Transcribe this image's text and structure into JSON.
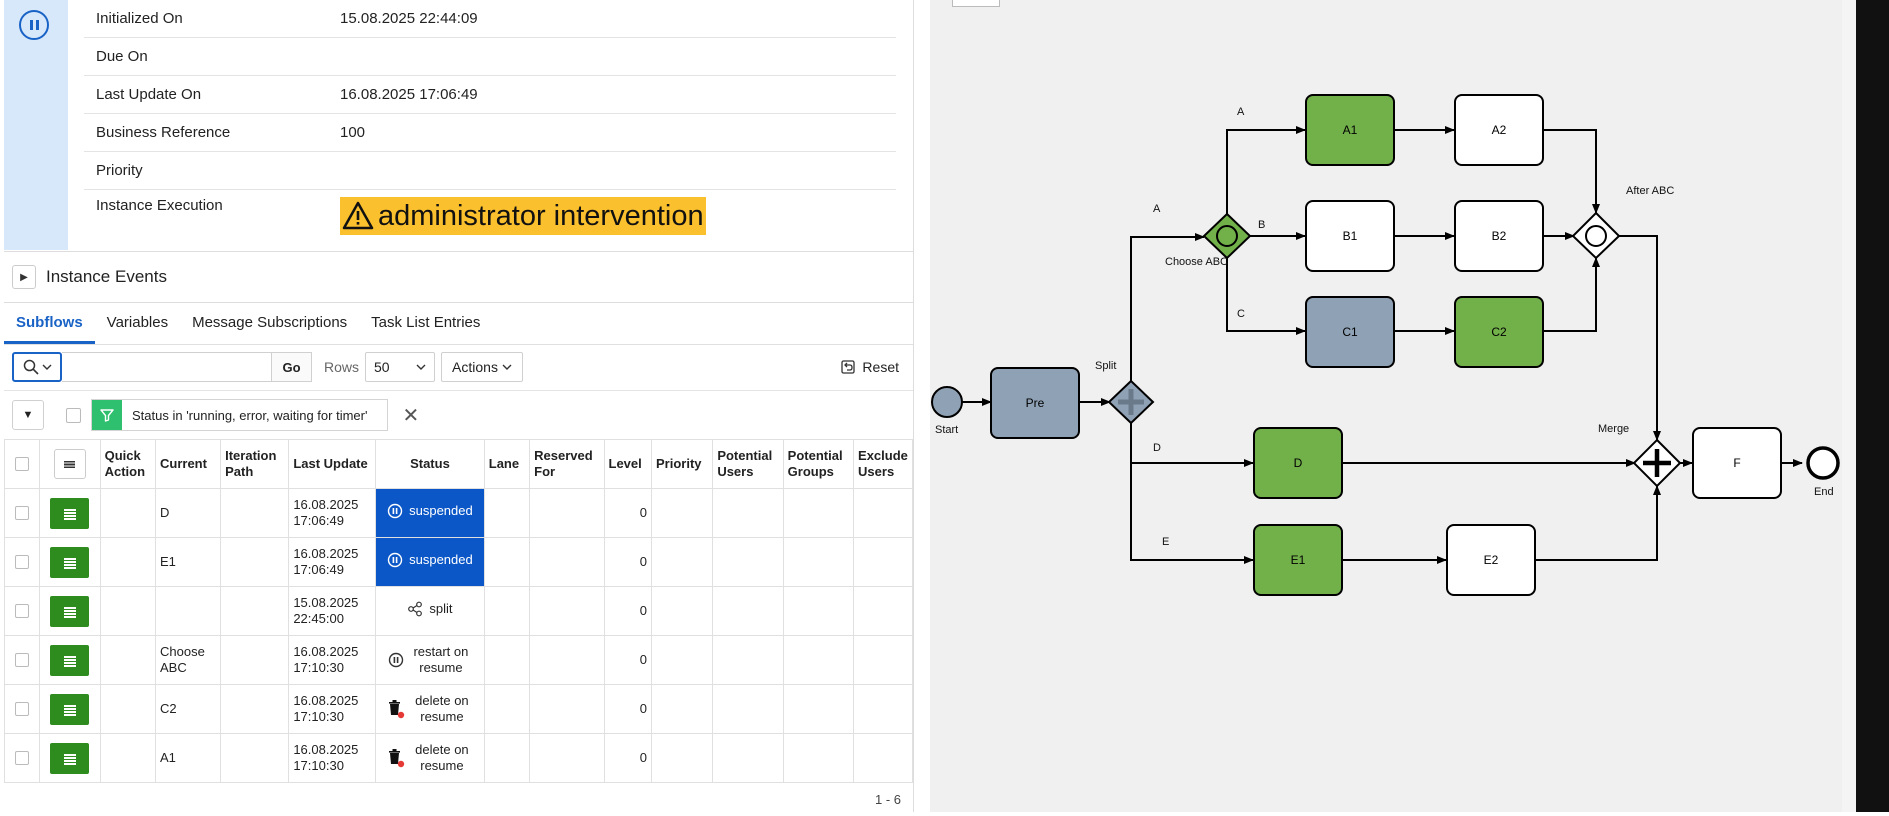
{
  "properties": [
    {
      "label": "Initialized On",
      "value": "15.08.2025 22:44:09"
    },
    {
      "label": "Due On",
      "value": ""
    },
    {
      "label": "Last Update On",
      "value": "16.08.2025 17:06:49"
    },
    {
      "label": "Business Reference",
      "value": "100"
    },
    {
      "label": "Priority",
      "value": ""
    },
    {
      "label": "Instance Execution",
      "value": "administrator intervention"
    }
  ],
  "events": {
    "title": "Instance Events"
  },
  "tabs": [
    {
      "label": "Subflows",
      "active": true
    },
    {
      "label": "Variables",
      "active": false
    },
    {
      "label": "Message Subscriptions",
      "active": false
    },
    {
      "label": "Task List Entries",
      "active": false
    }
  ],
  "toolbar": {
    "search_value": "",
    "go_label": "Go",
    "rows_label": "Rows",
    "rows_value": "50",
    "actions_label": "Actions",
    "reset_label": "Reset"
  },
  "filter": {
    "text": "Status in 'running, error, waiting for timer'"
  },
  "table": {
    "columns": [
      {
        "label": "",
        "width": 36
      },
      {
        "label": "",
        "width": 62
      },
      {
        "label": "Quick Action",
        "width": 56
      },
      {
        "label": "Current",
        "width": 66
      },
      {
        "label": "Iteration Path",
        "width": 69
      },
      {
        "label": "Last Update",
        "width": 88
      },
      {
        "label": "Status",
        "width": 110
      },
      {
        "label": "Lane",
        "width": 46
      },
      {
        "label": "Reserved For",
        "width": 75
      },
      {
        "label": "Level",
        "width": 48
      },
      {
        "label": "Priority",
        "width": 62
      },
      {
        "label": "Potential Users",
        "width": 71
      },
      {
        "label": "Potential Groups",
        "width": 71
      },
      {
        "label": "Exclude Users",
        "width": 44
      }
    ],
    "rows": [
      {
        "current": "D",
        "last_update": "16.08.2025 17:06:49",
        "status": "suspended",
        "kind": "suspended",
        "level": "0"
      },
      {
        "current": "E1",
        "last_update": "16.08.2025 17:06:49",
        "status": "suspended",
        "kind": "suspended",
        "level": "0"
      },
      {
        "current": "",
        "last_update": "15.08.2025 22:45:00",
        "status": "split",
        "kind": "split",
        "level": "0"
      },
      {
        "current": "Choose ABC",
        "last_update": "16.08.2025 17:10:30",
        "status": "restart on resume",
        "kind": "restart",
        "level": "0"
      },
      {
        "current": "C2",
        "last_update": "16.08.2025 17:10:30",
        "status": "delete on resume",
        "kind": "delete",
        "level": "0"
      },
      {
        "current": "A1",
        "last_update": "16.08.2025 17:10:30",
        "status": "delete on resume",
        "kind": "delete",
        "level": "0"
      }
    ],
    "pagination": "1 - 6"
  },
  "diagram": {
    "colors": {
      "green": "#72b04a",
      "gray": "#8fa1b4",
      "white": "#ffffff",
      "stroke": "#000000"
    },
    "tasks": [
      {
        "id": "pre",
        "label": "Pre",
        "fill": "gray"
      },
      {
        "id": "a1",
        "label": "A1",
        "fill": "green"
      },
      {
        "id": "a2",
        "label": "A2",
        "fill": "white"
      },
      {
        "id": "b1",
        "label": "B1",
        "fill": "white"
      },
      {
        "id": "b2",
        "label": "B2",
        "fill": "white"
      },
      {
        "id": "c1",
        "label": "C1",
        "fill": "gray"
      },
      {
        "id": "c2",
        "label": "C2",
        "fill": "green"
      },
      {
        "id": "d",
        "label": "D",
        "fill": "green"
      },
      {
        "id": "e1",
        "label": "E1",
        "fill": "green"
      },
      {
        "id": "e2",
        "label": "E2",
        "fill": "white"
      },
      {
        "id": "f",
        "label": "F",
        "fill": "white"
      }
    ],
    "labels": {
      "start": "Start",
      "end": "End",
      "split": "Split",
      "choose": "Choose ABC",
      "after": "After ABC",
      "merge": "Merge",
      "flow_a_top": "A",
      "flow_a": "A",
      "flow_b": "B",
      "flow_c": "C",
      "flow_d": "D",
      "flow_e": "E"
    }
  }
}
